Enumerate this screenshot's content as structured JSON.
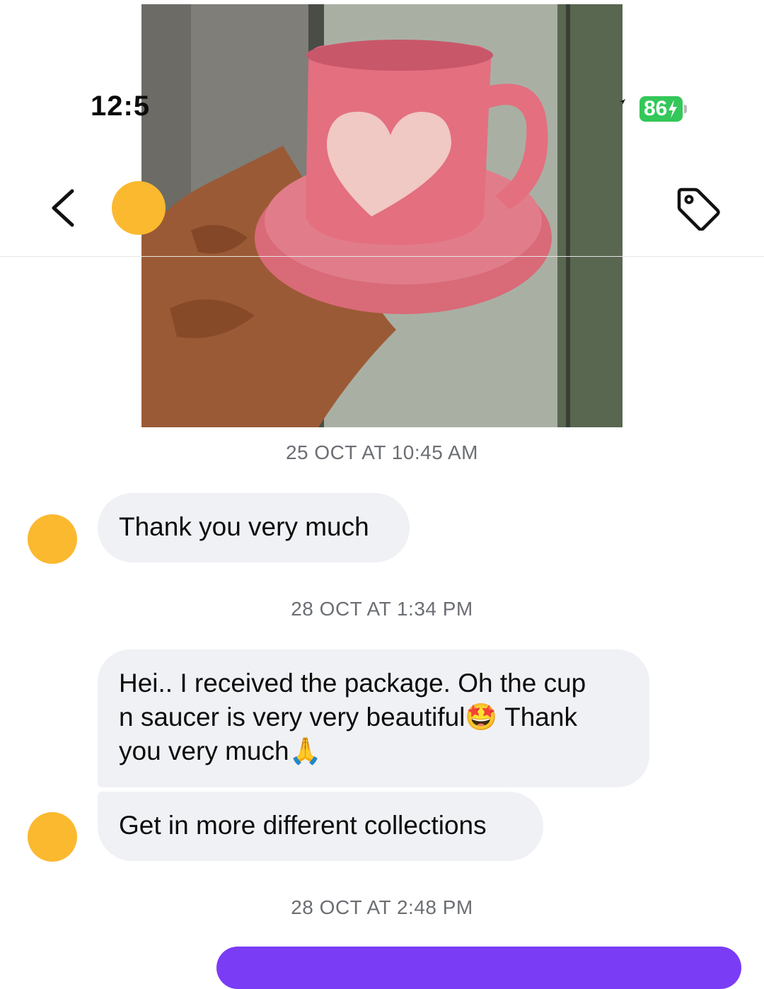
{
  "status_bar": {
    "time": "12:5",
    "battery": "86"
  },
  "header": {
    "back_icon": "chevron-left-icon",
    "tag_icon": "tag-icon"
  },
  "photo": {
    "icon": "photo-attachment"
  },
  "thread": [
    {
      "type": "timestamp",
      "text": "25 OCT AT 10:45 AM"
    },
    {
      "type": "message",
      "text": "Thank you very much"
    },
    {
      "type": "timestamp",
      "text": "28 OCT AT 1:34 PM"
    },
    {
      "type": "message",
      "lines": [
        "Hei.. I received the package. Oh the cup",
        "n saucer is very very beautiful🤩 Thank",
        "you very much🙏"
      ]
    },
    {
      "type": "message",
      "text": "Get in more different collections"
    },
    {
      "type": "timestamp",
      "text": "28 OCT AT 2:48 PM"
    }
  ],
  "colors": {
    "avatar": "#fbb92f",
    "bubble": "#f0f1f4",
    "accent": "#7b3cf5",
    "battery": "#34c759"
  }
}
